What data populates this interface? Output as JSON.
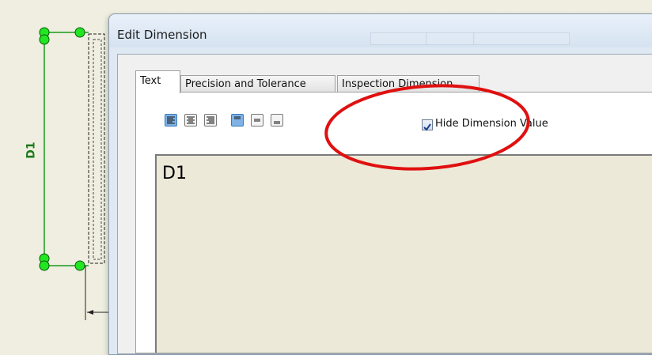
{
  "dialog": {
    "title": "Edit Dimension",
    "tabs": [
      {
        "label": "Text",
        "active": true
      },
      {
        "label": "Precision and Tolerance",
        "active": false
      },
      {
        "label": "Inspection Dimension",
        "active": false
      }
    ],
    "toolbar": {
      "buttons": [
        {
          "icon": "align-left-icon",
          "selected": true
        },
        {
          "icon": "align-center-icon",
          "selected": false
        },
        {
          "icon": "align-right-icon",
          "selected": false
        },
        {
          "icon": "align-top-icon",
          "selected": true
        },
        {
          "icon": "align-middle-icon",
          "selected": false
        },
        {
          "icon": "align-bottom-icon",
          "selected": false
        }
      ]
    },
    "hide_value": {
      "label": "Hide Dimension Value",
      "checked": true
    },
    "text_value": "D1"
  },
  "drawing": {
    "dimension_label": "D1",
    "grip_color": "#22e622",
    "line_color": "#1c9a1c"
  },
  "annotation": {
    "color": "#e01010"
  }
}
